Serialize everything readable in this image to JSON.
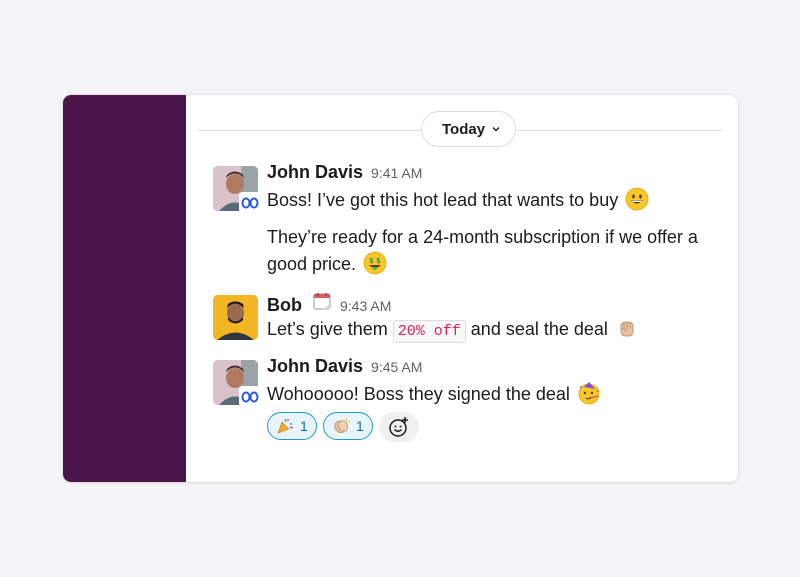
{
  "date_divider": {
    "label": "Today"
  },
  "messages": [
    {
      "author": "John Davis",
      "time": "9:41 AM",
      "lines": [
        {
          "text": "Boss! I’ve got this hot lead that wants to buy",
          "emoji": "grinning-face"
        },
        {
          "text": "They’re ready for a 24-month subscription if we offer a",
          "emoji": ""
        },
        {
          "text": "good price.",
          "emoji": "money-mouth-face"
        }
      ]
    },
    {
      "author": "Bob",
      "status_emoji": "calendar",
      "time": "9:43 AM",
      "text_before": "Let’s give them",
      "code": "20% off",
      "text_after": "and seal the deal",
      "emoji": "raised-fist"
    },
    {
      "author": "John Davis",
      "time": "9:45 AM",
      "text": "Wohooooo! Boss they signed the deal",
      "emoji": "partying-face",
      "reactions": [
        {
          "emoji": "party-popper",
          "count": "1"
        },
        {
          "emoji": "clapping-hands",
          "count": "1"
        }
      ]
    }
  ],
  "colors": {
    "sidebar": "#4a154b",
    "reaction_border": "#1d9bd1",
    "code_text": "#e01e5a"
  }
}
